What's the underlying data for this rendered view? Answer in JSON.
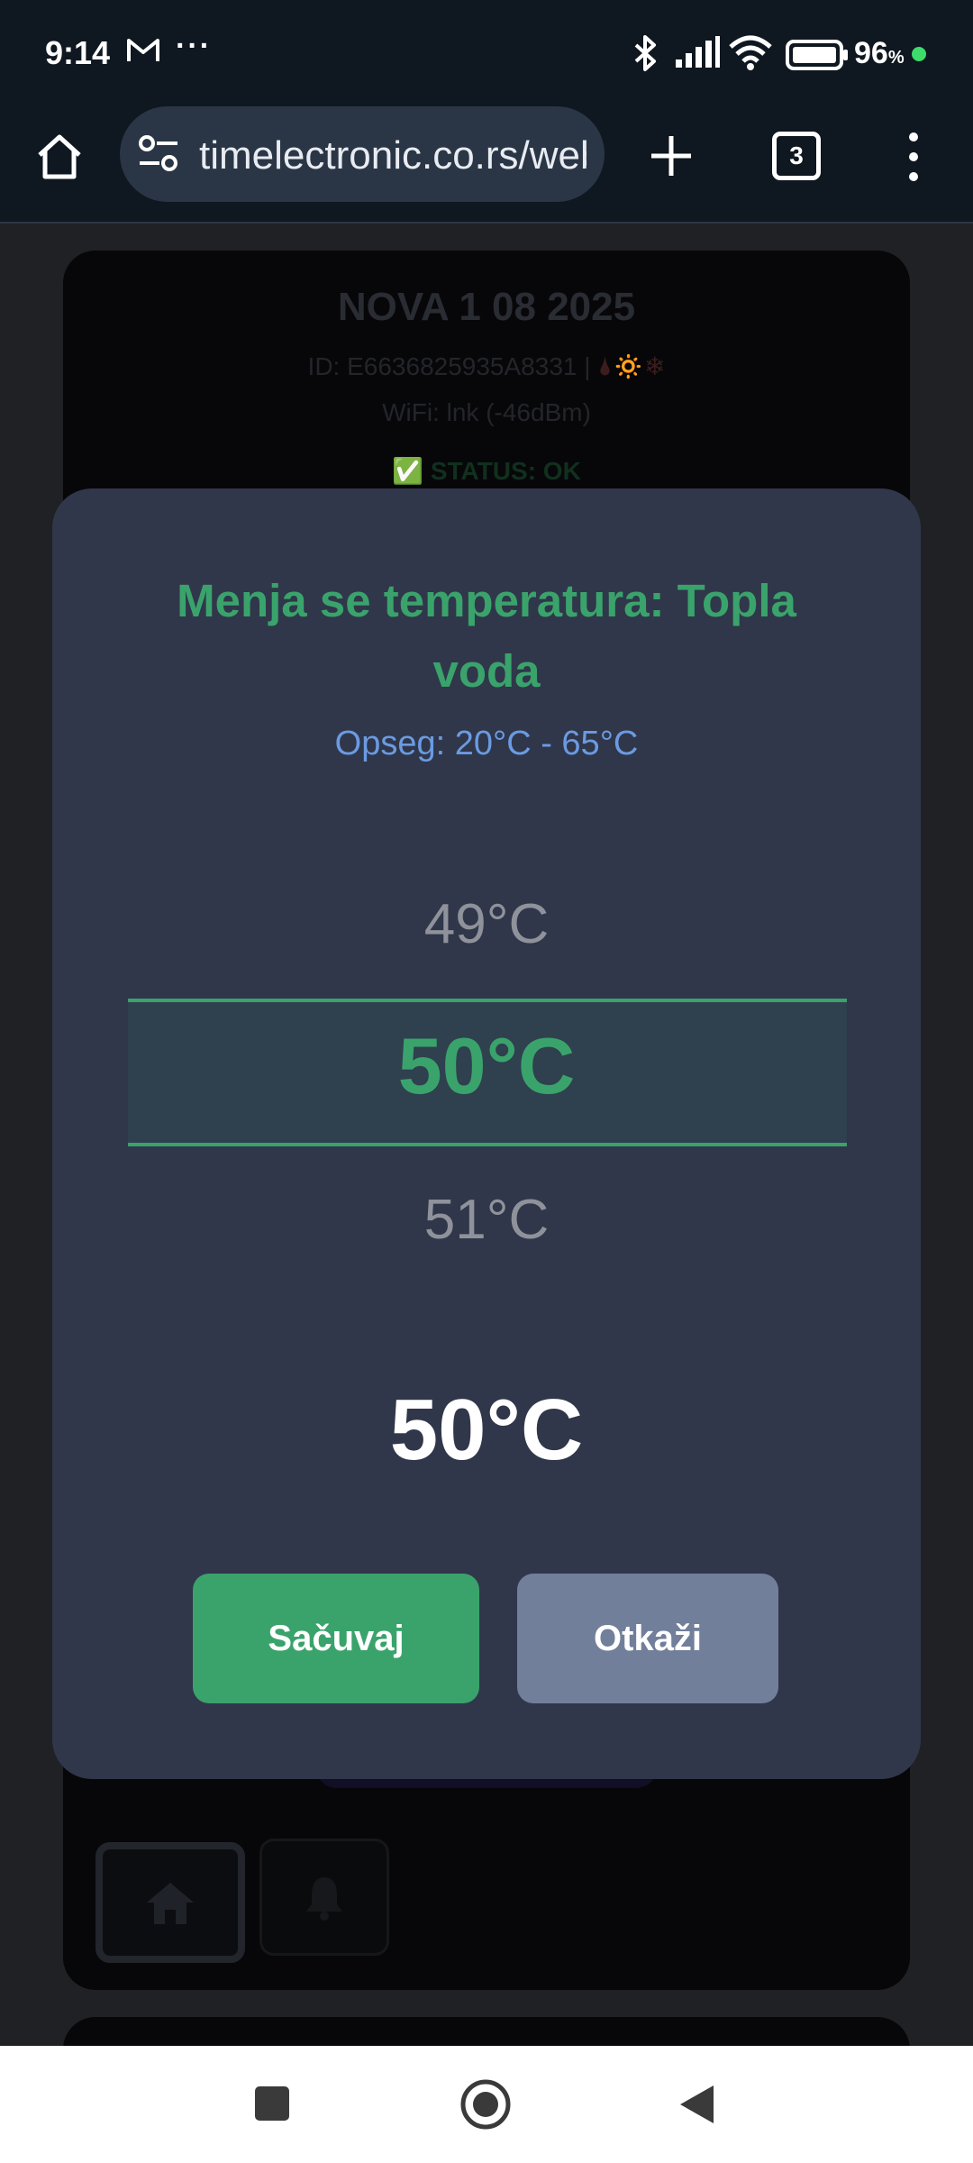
{
  "status_bar": {
    "time": "9:14",
    "more": "···",
    "battery": "96",
    "battery_unit": "%",
    "icons": [
      "gmail-icon",
      "bluetooth-icon",
      "signal-icon",
      "wifi-icon",
      "battery-icon",
      "privacy-dot-icon"
    ]
  },
  "browser": {
    "url": "timelectronic.co.rs/web",
    "tab_count": "3",
    "icons": [
      "home-icon",
      "site-settings-icon",
      "new-tab-plus-icon",
      "tab-switcher-icon",
      "overflow-menu-icon"
    ]
  },
  "background_card": {
    "title": "NOVA 1 08 2025",
    "id_line": "ID: E6636825935A8331 | ",
    "id_emojis": "🌢🔅❄",
    "wifi_line": "WiFi: lnk (-46dBm)",
    "status": "✅ STATUS: OK",
    "nav_icons": [
      "home-icon",
      "bell-icon"
    ]
  },
  "modal": {
    "title": "Menja se temperatura: Topla voda",
    "range": "Opseg: 20°C - 65°C",
    "picker": {
      "previous": "49°C",
      "current": "50°C",
      "next": "51°C"
    },
    "selected_value": "50°C",
    "save_label": "Sačuvaj",
    "cancel_label": "Otkaži"
  },
  "colors": {
    "accent_green": "#3aa36c",
    "range_blue": "#6a9be3",
    "modal_bg": "#30374a",
    "cancel_gray": "#727f9b"
  },
  "system_nav": {
    "icons": [
      "recents-square-icon",
      "home-circle-icon",
      "back-triangle-icon"
    ]
  }
}
